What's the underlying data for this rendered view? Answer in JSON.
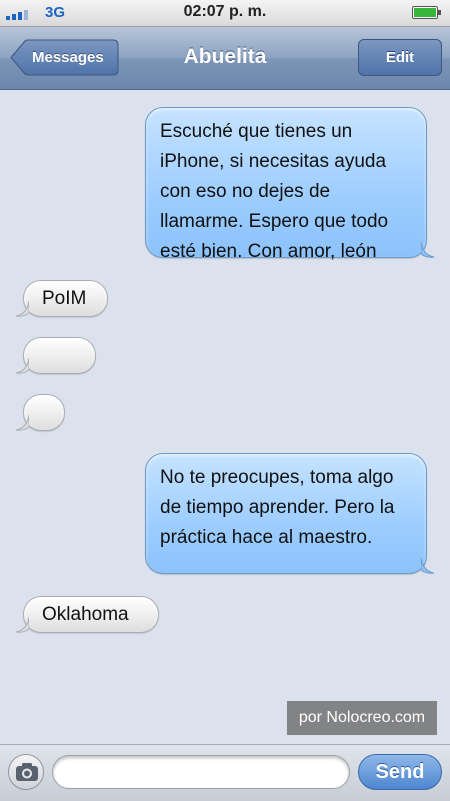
{
  "status_bar": {
    "network": "3G",
    "time": "02:07 p. m.",
    "battery_level": 0.9,
    "signal_bars": 4
  },
  "nav": {
    "back_label": "Messages",
    "title": "Abuelita",
    "edit_label": "Edit"
  },
  "messages": [
    {
      "direction": "out",
      "text": "Escuché que tienes un iPhone, si necesitas ayuda con eso no dejes de llamarme. Espero que todo esté bien. Con amor, león"
    },
    {
      "direction": "in",
      "text": "PoIM"
    },
    {
      "direction": "in",
      "text": ""
    },
    {
      "direction": "in",
      "text": ""
    },
    {
      "direction": "out",
      "text": "No te preocupes, toma algo de tiempo aprender. Pero la práctica hace al maestro."
    },
    {
      "direction": "in",
      "text": "Oklahoma"
    }
  ],
  "watermark": "por Nolocreo.com",
  "composer": {
    "input_value": "",
    "send_label": "Send"
  },
  "colors": {
    "outgoing_bubble": "#9dcdff",
    "incoming_bubble": "#ececec",
    "nav_bar": "#8ca3c1",
    "battery_fill": "#36b73a",
    "network_text": "#1a66c2"
  },
  "icons": {
    "camera": "camera-icon",
    "back": "back-arrow-button"
  }
}
